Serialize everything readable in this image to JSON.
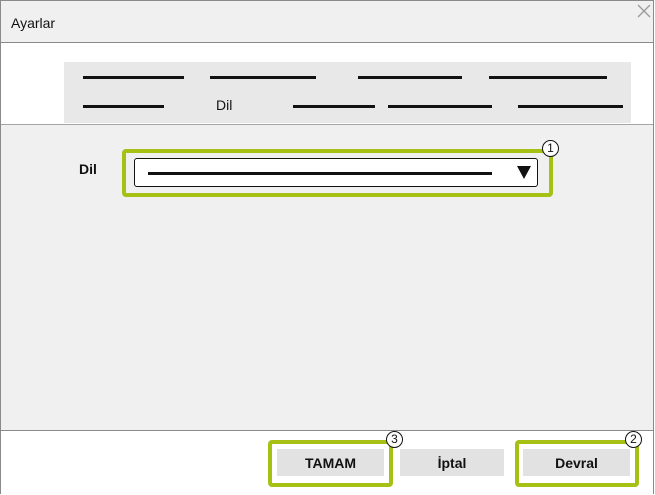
{
  "window": {
    "title": "Ayarlar"
  },
  "tabs": {
    "active_label": "Dil"
  },
  "language_field": {
    "label": "Dil"
  },
  "buttons": {
    "ok": "TAMAM",
    "cancel": "İptal",
    "apply": "Devral"
  },
  "callouts": [
    "1",
    "2",
    "3"
  ],
  "icons": {
    "close": "close-icon",
    "dropdown": "chevron-down-icon"
  },
  "colors": {
    "highlight": "#a7c014",
    "panel_bg": "#f0f0f0",
    "button_bg": "#e2e2e2"
  }
}
